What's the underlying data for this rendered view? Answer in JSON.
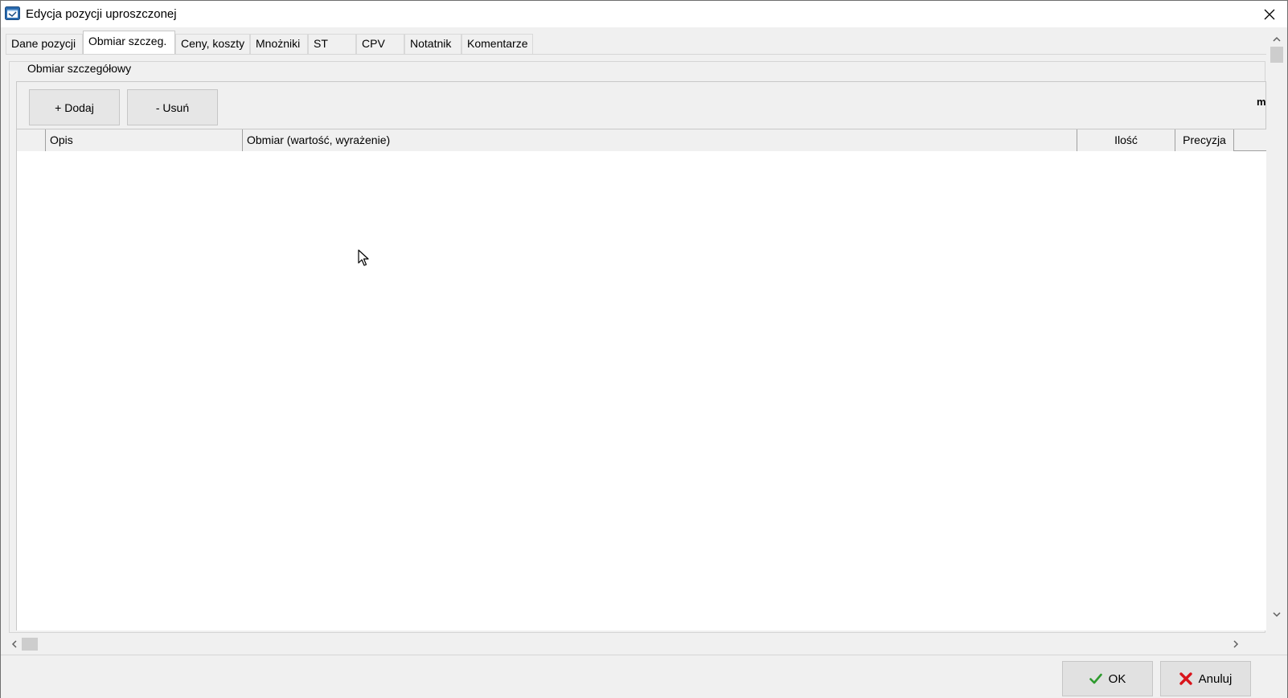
{
  "window": {
    "title": "Edycja pozycji uproszczonej",
    "icon": "app-window-icon",
    "close_icon": "close-icon"
  },
  "tabs": [
    {
      "label": "Dane pozycji",
      "active": false
    },
    {
      "label": "Obmiar szczeg.",
      "active": true
    },
    {
      "label": "Ceny, koszty",
      "active": false
    },
    {
      "label": "Mnożniki",
      "active": false
    },
    {
      "label": "ST",
      "active": false
    },
    {
      "label": "CPV",
      "active": false
    },
    {
      "label": "Notatnik",
      "active": false
    },
    {
      "label": "Komentarze",
      "active": false
    }
  ],
  "section": {
    "title": "Obmiar szczegółowy",
    "add_label": "+ Dodaj",
    "remove_label": "- Usuń",
    "unit": "m"
  },
  "grid": {
    "columns": [
      "",
      "Opis",
      "Obmiar (wartość, wyrażenie)",
      "Ilość",
      "Precyzja"
    ],
    "rows": []
  },
  "footer": {
    "ok_label": "OK",
    "cancel_label": "Anuluj",
    "ok_icon": "checkmark-icon",
    "cancel_icon": "cross-icon"
  },
  "colors": {
    "window_bg": "#f0f0f0",
    "ok_check": "#2e9b2e",
    "cancel_cross": "#d9141b"
  }
}
